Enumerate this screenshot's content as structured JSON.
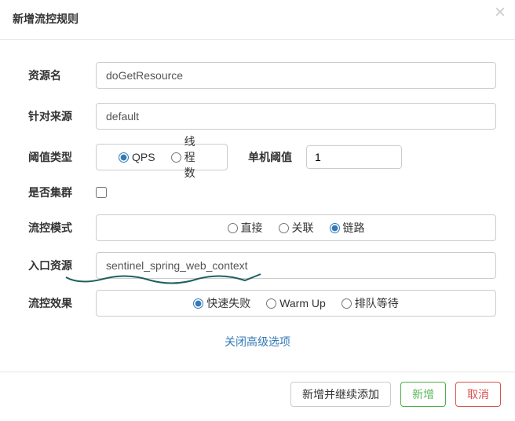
{
  "header": {
    "title": "新增流控规则"
  },
  "form": {
    "resourceLabel": "资源名",
    "resourceValue": "doGetResource",
    "sourceLabel": "针对来源",
    "sourceValue": "default",
    "thresholdTypeLabel": "阈值类型",
    "thresholdTypeOptions": {
      "qps": "QPS",
      "thread": "线程数"
    },
    "singleThresholdLabel": "单机阈值",
    "singleThresholdValue": "1",
    "clusterLabel": "是否集群",
    "modeLabel": "流控模式",
    "modeOptions": {
      "direct": "直接",
      "relate": "关联",
      "chain": "链路"
    },
    "entryLabel": "入口资源",
    "entryValue": "sentinel_spring_web_context",
    "effectLabel": "流控效果",
    "effectOptions": {
      "fast": "快速失败",
      "warm": "Warm Up",
      "queue": "排队等待"
    },
    "advancedLink": "关闭高级选项"
  },
  "footer": {
    "addContinue": "新增并继续添加",
    "add": "新增",
    "cancel": "取消"
  }
}
